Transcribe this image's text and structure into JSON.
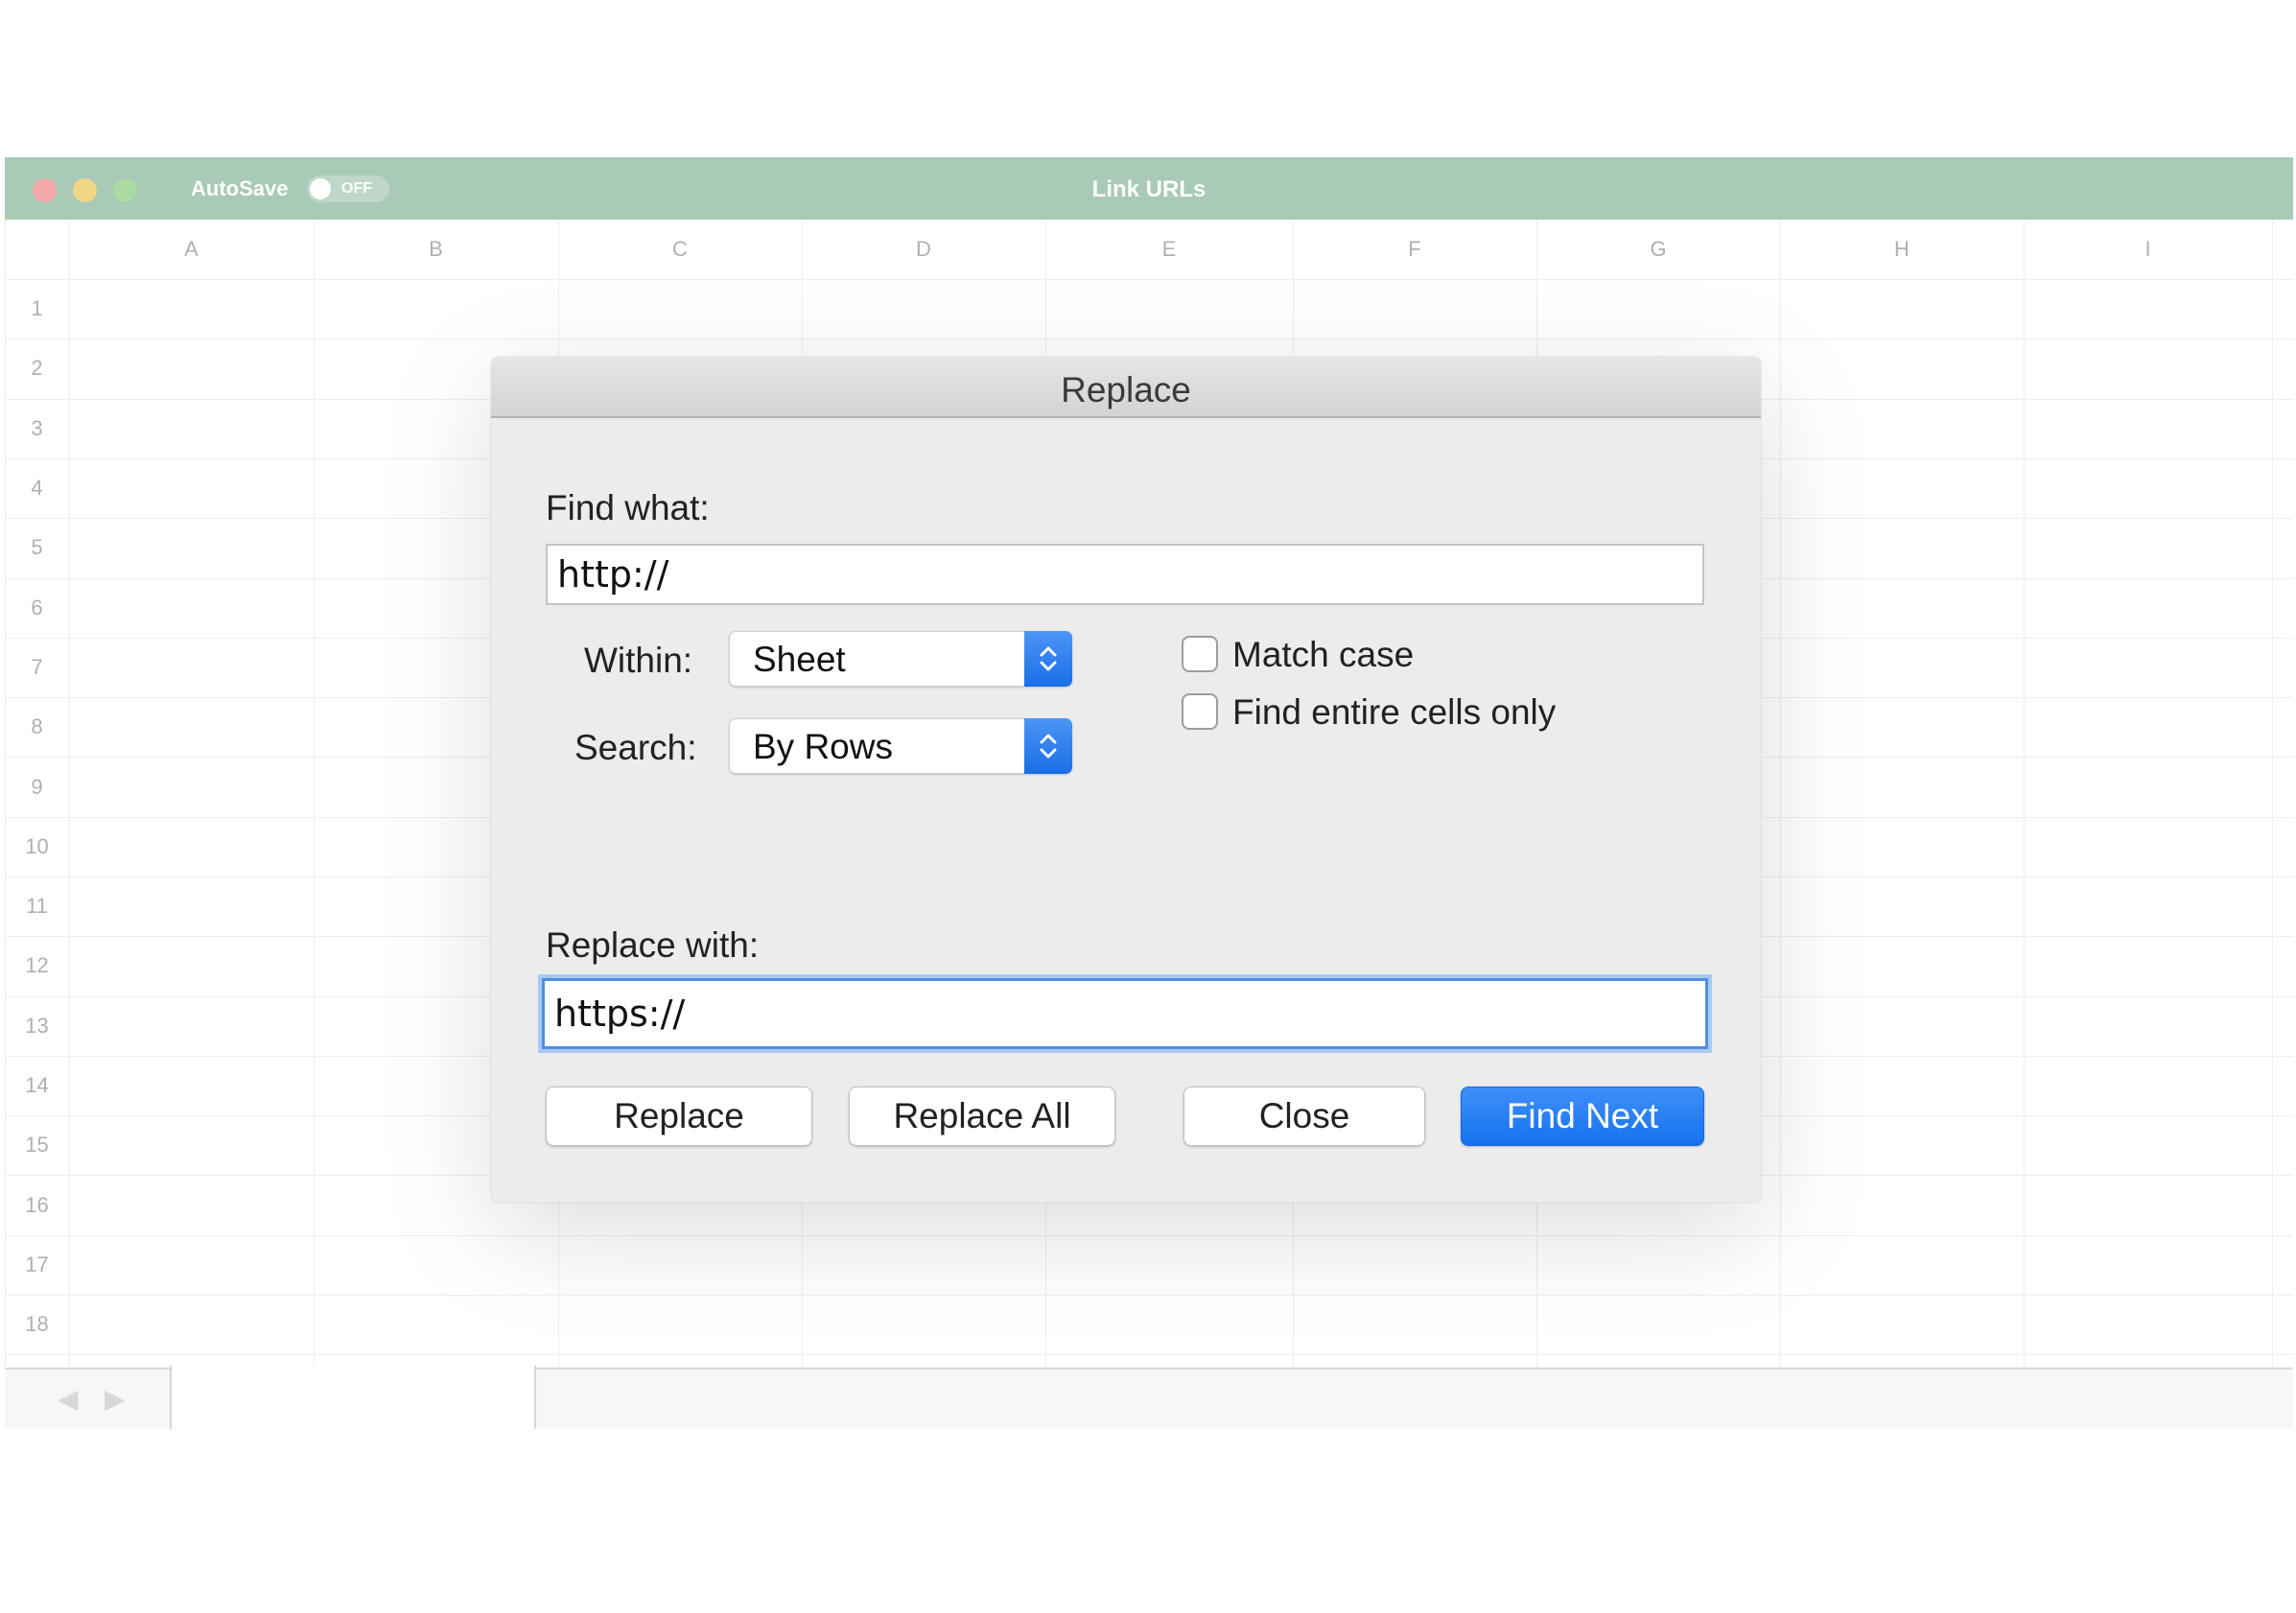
{
  "window": {
    "title": "Link URLs",
    "autosave_label": "AutoSave",
    "autosave_state": "OFF",
    "traffic_lights": {
      "close": "#f3a8a8",
      "minimize": "#f2d687",
      "zoom": "#a9dba2"
    },
    "titlebar_color": "#a8cab6"
  },
  "grid": {
    "columns": [
      "A",
      "B",
      "C",
      "D",
      "E",
      "F",
      "G",
      "H",
      "I"
    ],
    "rows": [
      "1",
      "2",
      "3",
      "4",
      "5",
      "6",
      "7",
      "8",
      "9",
      "10",
      "11",
      "12",
      "13",
      "14",
      "15",
      "16",
      "17",
      "18"
    ]
  },
  "sheet_nav": {
    "prev_icon": "chevron-left-icon",
    "next_icon": "chevron-right-icon"
  },
  "dialog": {
    "title": "Replace",
    "find_label": "Find what:",
    "find_value": "http://",
    "within_label": "Within:",
    "within_value": "Sheet",
    "search_label": "Search:",
    "search_value": "By Rows",
    "match_case_label": "Match case",
    "entire_cells_label": "Find entire cells only",
    "replace_label": "Replace with:",
    "replace_value": "https://",
    "buttons": {
      "replace": "Replace",
      "replace_all": "Replace All",
      "close": "Close",
      "find_next": "Find Next"
    },
    "accent_color": "#1672ee"
  }
}
